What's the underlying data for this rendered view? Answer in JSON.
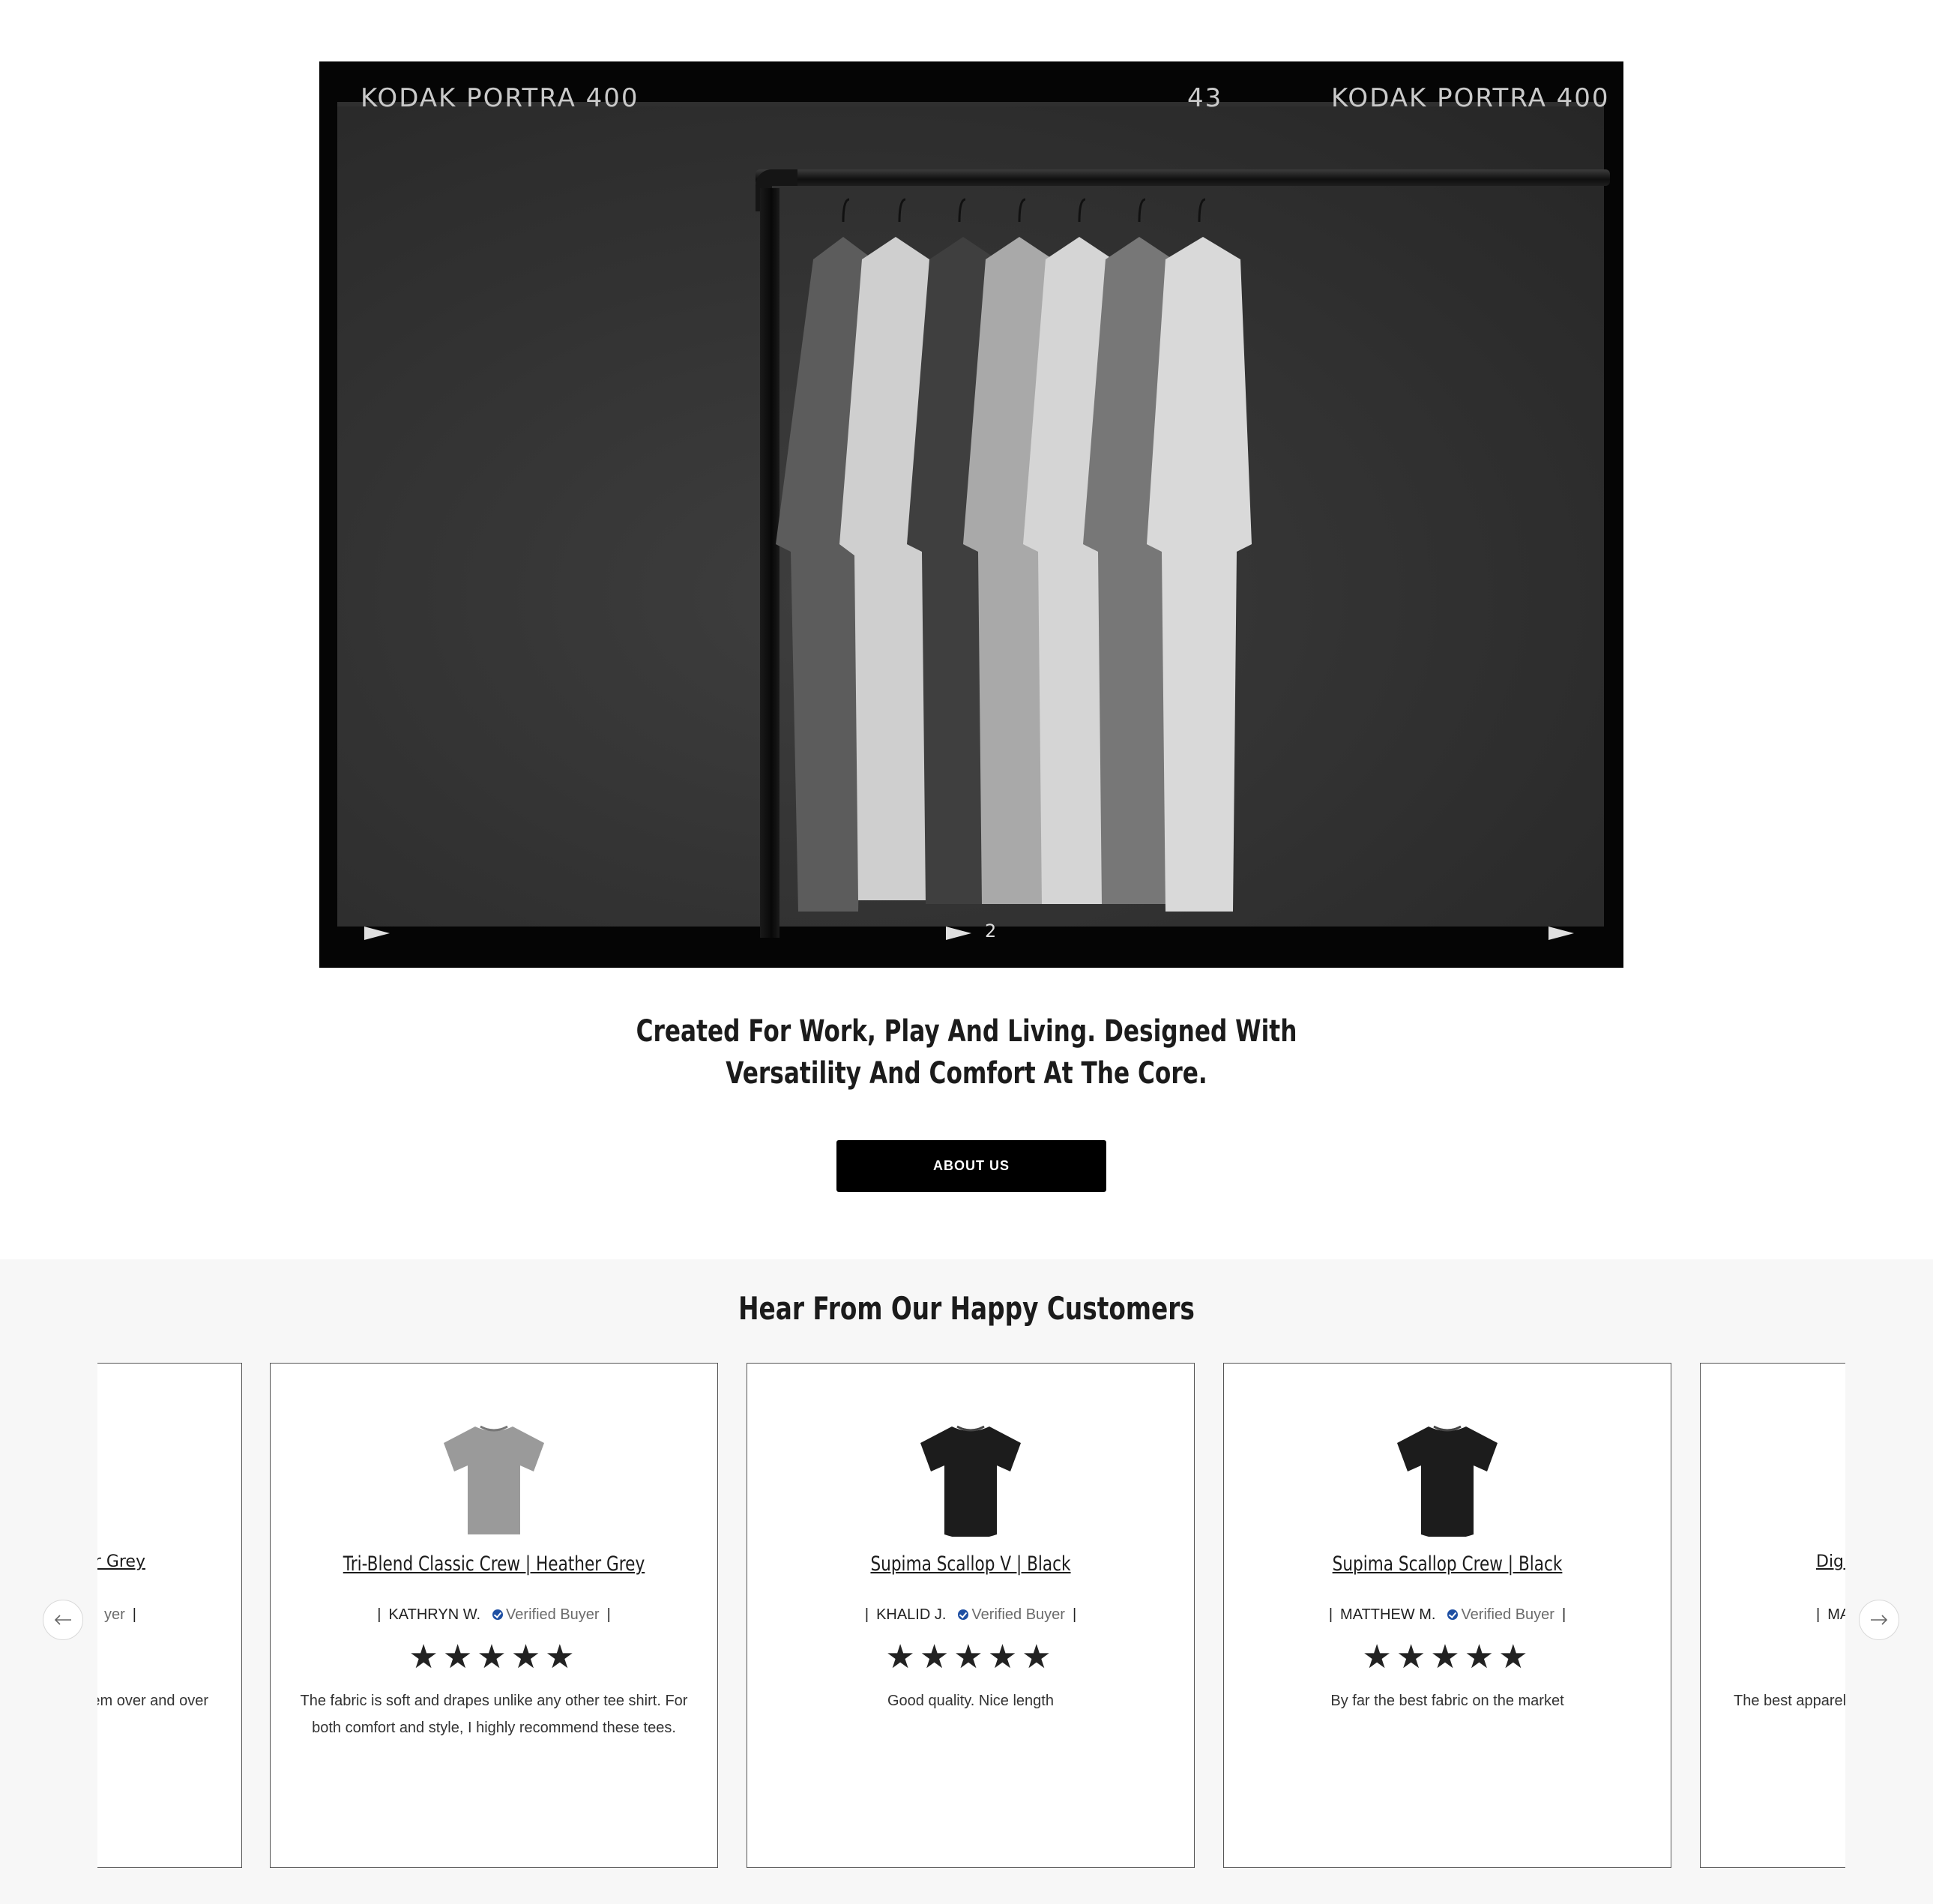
{
  "hero": {
    "film_left": "KODAK PORTRA 400",
    "film_frame": "43",
    "film_right": "KODAK PORTRA 400",
    "film_bottom_num": "2"
  },
  "about": {
    "headline_line1": "Created For Work, Play And Living. Designed With",
    "headline_line2": "Versatility And Comfort At The Core.",
    "button_label": "ABOUT US"
  },
  "reviews": {
    "title": "Hear From Our Happy Customers",
    "prev_icon": "arrow-left-icon",
    "next_icon": "arrow-right-icon",
    "cards": [
      {
        "product": "er Grey",
        "reviewer": "",
        "verified": "yer",
        "stars": "★★★★★",
        "text": "em over and over",
        "shirt_color": "#9a9a9a"
      },
      {
        "product": "Tri-Blend Classic Crew | Heather Grey",
        "reviewer": "KATHRYN W.",
        "verified": "Verified Buyer",
        "stars": "★★★★★",
        "text": "The fabric is soft and drapes unlike any other tee shirt. For both comfort and style, I highly recommend these tees.",
        "shirt_color": "#9a9a9a"
      },
      {
        "product": "Supima Scallop V | Black",
        "reviewer": "KHALID J.",
        "verified": "Verified Buyer",
        "stars": "★★★★★",
        "text": "Good quality. Nice length",
        "shirt_color": "#1c1c1c"
      },
      {
        "product": "Supima Scallop Crew | Black",
        "reviewer": "MATTHEW M.",
        "verified": "Verified Buyer",
        "stars": "★★★★★",
        "text": "By far the best fabric on the market",
        "shirt_color": "#1c1c1c"
      },
      {
        "product": "Digit",
        "reviewer": "MA",
        "verified": "",
        "stars": "",
        "text": "The best apparel",
        "shirt_color": "#1c1c1c"
      }
    ]
  }
}
